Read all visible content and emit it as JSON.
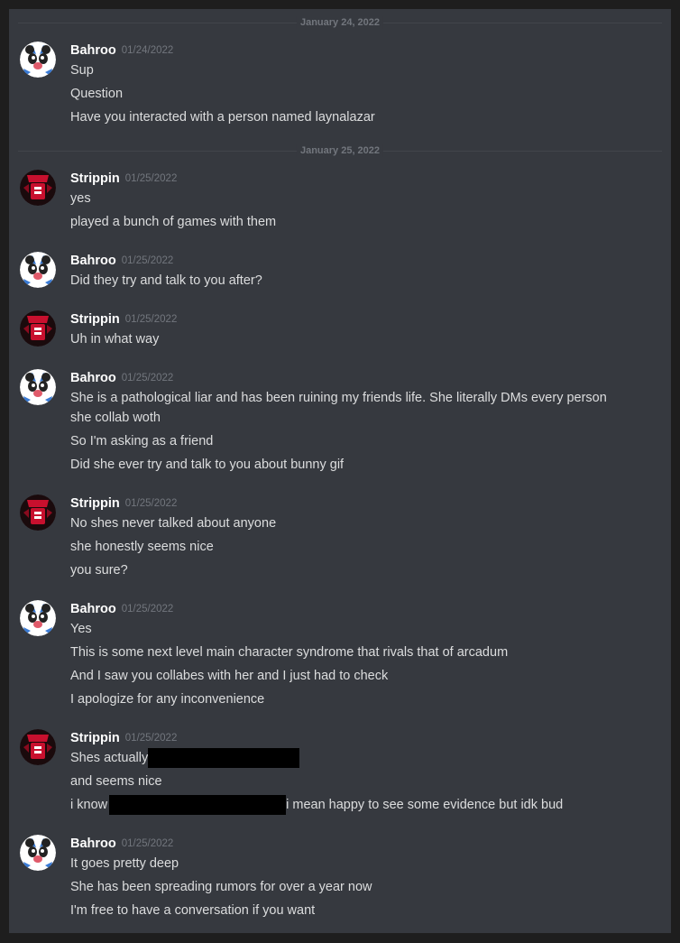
{
  "dividers": [
    "January 24, 2022",
    "January 25, 2022"
  ],
  "users": {
    "bahroo": {
      "name": "Bahroo",
      "avatar_icon": "panda-avatar-icon"
    },
    "strippin": {
      "name": "Strippin",
      "avatar_icon": "red-logo-avatar-icon"
    }
  },
  "messages": [
    {
      "author": "Bahroo",
      "time": "01/24/2022",
      "lines": [
        "Sup",
        "Question",
        "Have you interacted with a person named laynalazar"
      ]
    },
    {
      "author": "Strippin",
      "time": "01/25/2022",
      "lines": [
        "yes",
        "played a bunch of games with them"
      ]
    },
    {
      "author": "Bahroo",
      "time": "01/25/2022",
      "lines": [
        "Did they try and talk to you after?"
      ]
    },
    {
      "author": "Strippin",
      "time": "01/25/2022",
      "lines": [
        "Uh in what way"
      ]
    },
    {
      "author": "Bahroo",
      "time": "01/25/2022",
      "lines": [
        "She is a pathological liar and has been ruining my friends life. She literally DMs every person",
        "she collab woth",
        "So I'm asking as a friend",
        "Did she ever try and talk to you about bunny gif"
      ]
    },
    {
      "author": "Strippin",
      "time": "01/25/2022",
      "lines": [
        "No shes never talked about anyone",
        "she honestly seems nice",
        "you sure?"
      ]
    },
    {
      "author": "Bahroo",
      "time": "01/25/2022",
      "lines": [
        "Yes",
        "This is some next level main character syndrome that rivals that of arcadum",
        "And I saw you collabes with her and I just had to check",
        "I apologize for any inconvenience"
      ]
    },
    {
      "author": "Strippin",
      "time": "01/25/2022",
      "lines": [
        "Shes actually",
        "and seems nice",
        "i know",
        "i mean happy to see some evidence but idk bud"
      ]
    },
    {
      "author": "Bahroo",
      "time": "01/25/2022",
      "lines": [
        "It goes pretty deep",
        "She has been spreading rumors for over a year now",
        "I'm free to have a conversation if you want"
      ]
    }
  ]
}
